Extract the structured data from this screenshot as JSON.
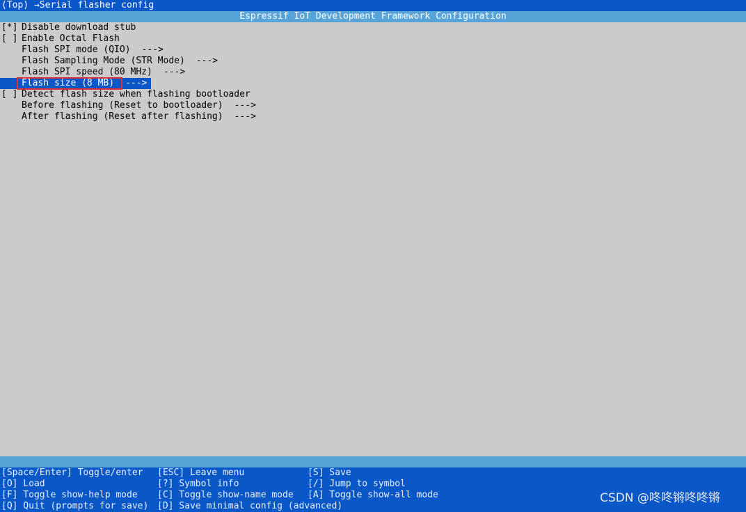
{
  "titlebar": {
    "breadcrumb": "(Top) →Serial flasher config"
  },
  "appbar": {
    "title": "Espressif IoT Development Framework Configuration"
  },
  "menu": {
    "items": [
      {
        "prefix": "[*]",
        "label": "Disable download stub",
        "arrow": ""
      },
      {
        "prefix": "[ ]",
        "label": "Enable Octal Flash",
        "arrow": ""
      },
      {
        "prefix": "",
        "label": "Flash SPI mode (QIO)",
        "arrow": "--->"
      },
      {
        "prefix": "",
        "label": "Flash Sampling Mode (STR Mode)",
        "arrow": "--->"
      },
      {
        "prefix": "",
        "label": "Flash SPI speed (80 MHz)",
        "arrow": "--->"
      },
      {
        "prefix": "",
        "label": "Flash size (8 MB)",
        "arrow": "--->",
        "selected": true
      },
      {
        "prefix": "[ ]",
        "label": "Detect flash size when flashing bootloader",
        "arrow": ""
      },
      {
        "prefix": "",
        "label": "Before flashing (Reset to bootloader)",
        "arrow": "--->"
      },
      {
        "prefix": "",
        "label": "After flashing (Reset after flashing)",
        "arrow": "--->"
      }
    ]
  },
  "keys": {
    "space_enter": "[Space/Enter] Toggle/enter",
    "esc": "[ESC] Leave menu",
    "save": "[S] Save",
    "load": "[O] Load",
    "symbol_info": "[?] Symbol info",
    "jump": "[/] Jump to symbol",
    "toggle_help": "[F] Toggle show-help mode",
    "toggle_name": "[C] Toggle show-name mode",
    "toggle_all": "[A] Toggle show-all mode",
    "quit": "[Q] Quit (prompts for save)",
    "save_minimal": "[D] Save minimal config (advanced)"
  },
  "watermark": "CSDN @咚咚锵咚咚锵",
  "colors": {
    "titlebar_bg": "#0a57c8",
    "appbar_bg": "#58a4d9",
    "content_bg": "#cbcbcb",
    "selected_bg": "#0a57c8",
    "highlight_border": "#e03030"
  }
}
